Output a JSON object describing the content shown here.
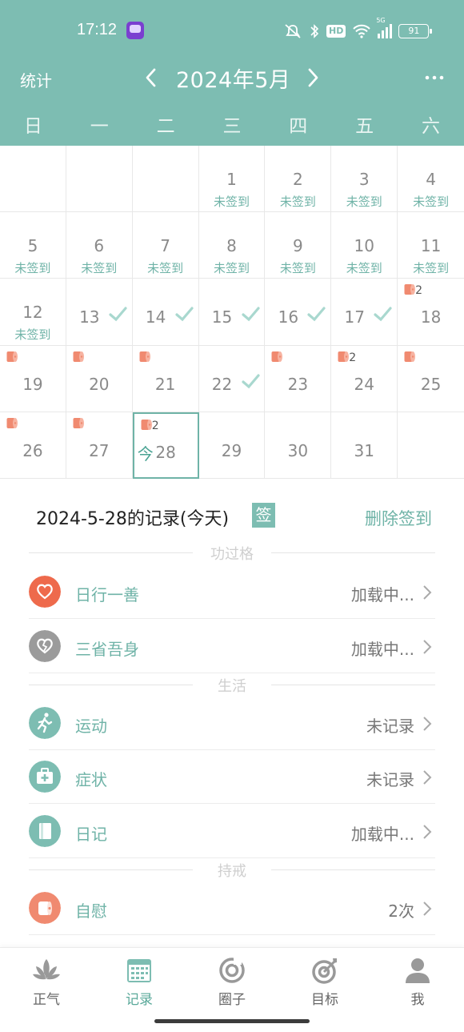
{
  "status": {
    "time": "17:12",
    "hd": "HD",
    "net": "5G",
    "battery": "91"
  },
  "header": {
    "stats_label": "统计",
    "month": "2024年5月"
  },
  "weekdays": [
    "日",
    "一",
    "二",
    "三",
    "四",
    "五",
    "六"
  ],
  "calendar": {
    "unsigned_label": "未签到",
    "today_label": "今",
    "days": [
      {
        "day": "1"
      },
      {
        "day": "2"
      },
      {
        "day": "3"
      },
      {
        "day": "4"
      },
      {
        "day": "5"
      },
      {
        "day": "6"
      },
      {
        "day": "7"
      },
      {
        "day": "8"
      },
      {
        "day": "9"
      },
      {
        "day": "10"
      },
      {
        "day": "11"
      },
      {
        "day": "12"
      },
      {
        "day": "13"
      },
      {
        "day": "14"
      },
      {
        "day": "15"
      },
      {
        "day": "16"
      },
      {
        "day": "17"
      },
      {
        "day": "18",
        "count": "2"
      },
      {
        "day": "19"
      },
      {
        "day": "20"
      },
      {
        "day": "21"
      },
      {
        "day": "22"
      },
      {
        "day": "23"
      },
      {
        "day": "24",
        "count": "2"
      },
      {
        "day": "25"
      },
      {
        "day": "26"
      },
      {
        "day": "27"
      },
      {
        "day": "28",
        "count": "2"
      },
      {
        "day": "29"
      },
      {
        "day": "30"
      },
      {
        "day": "31"
      }
    ]
  },
  "record": {
    "title": "2024-5-28的记录(今天)",
    "sign_badge": "签",
    "delete_sign": "删除签到",
    "sections": [
      {
        "title": "功过格",
        "items": [
          {
            "label": "日行一善",
            "value": "加载中...",
            "icon": "heart-icon",
            "color": "#ee6a4c"
          },
          {
            "label": "三省吾身",
            "value": "加载中...",
            "icon": "broken-heart-icon",
            "color": "#9b9b9b"
          }
        ]
      },
      {
        "title": "生活",
        "items": [
          {
            "label": "运动",
            "value": "未记录",
            "icon": "running-icon",
            "color": "#7dbdb2"
          },
          {
            "label": "症状",
            "value": "未记录",
            "icon": "medical-kit-icon",
            "color": "#7dbdb2"
          },
          {
            "label": "日记",
            "value": "加载中...",
            "icon": "notebook-icon",
            "color": "#7dbdb2"
          }
        ]
      },
      {
        "title": "持戒",
        "items": [
          {
            "label": "自慰",
            "value": "2次",
            "icon": "tissue-roll-icon",
            "color": "#f08a70"
          }
        ]
      }
    ]
  },
  "nav": [
    {
      "label": "正气",
      "icon": "lotus-icon"
    },
    {
      "label": "记录",
      "icon": "calendar-icon"
    },
    {
      "label": "圈子",
      "icon": "circle-icon"
    },
    {
      "label": "目标",
      "icon": "target-icon"
    },
    {
      "label": "我",
      "icon": "user-icon"
    }
  ],
  "colors": {
    "primary": "#7dbdb2",
    "accent_text": "#6fb3a7",
    "mark": "#f08a70"
  }
}
